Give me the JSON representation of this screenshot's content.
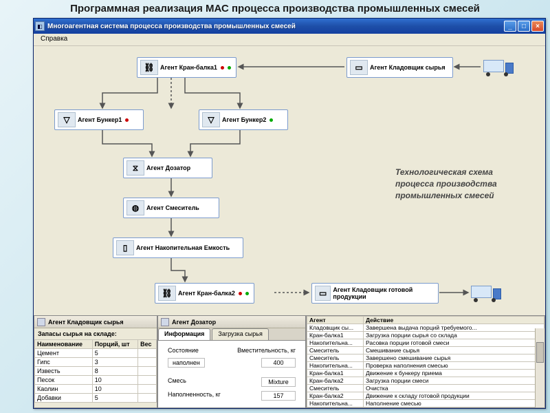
{
  "slide_title": "Программная реализация МАС процесса производства промышленных смесей",
  "window": {
    "title": "Многоагентная система процесса производства промышленных смесей",
    "menu": {
      "help": "Справка"
    }
  },
  "agents": {
    "crane1": "Агент Кран-балка1",
    "storekeeper_raw": "Агент Кладовщик сырья",
    "bunker1": "Агент Бункер1",
    "bunker2": "Агент Бункер2",
    "dozator": "Агент Дозатор",
    "mixer": "Агент Смеситель",
    "storage_tank": "Агент Накопительная Емкость",
    "crane2": "Агент Кран-балка2",
    "storekeeper_out": "Агент Кладовщик готовой продукции"
  },
  "scheme_caption": "Технологическая схема процесса производства промышленных смесей",
  "panel1": {
    "title": "Агент Кладовщик сырья",
    "subtitle": "Запасы сырья на складе:",
    "headers": {
      "name": "Наименование",
      "portions": "Порций, шт",
      "weight": "Вес"
    },
    "rows": [
      {
        "name": "Цемент",
        "p": "5"
      },
      {
        "name": "Гипс",
        "p": "3"
      },
      {
        "name": "Известь",
        "p": "8"
      },
      {
        "name": "Песок",
        "p": "10"
      },
      {
        "name": "Каолин",
        "p": "10"
      },
      {
        "name": "Добавки",
        "p": "5"
      }
    ]
  },
  "panel2": {
    "title": "Агент Дозатор",
    "tabs": {
      "info": "Информация",
      "load": "Загрузка сырья"
    },
    "rows": {
      "state_label": "Состояние",
      "capacity_label": "Вместительность, кг",
      "state": "наполнен",
      "capacity": "400",
      "mix_label": "Смесь",
      "mix": "Mixture",
      "fill_label": "Наполненность, кг",
      "fill": "157"
    }
  },
  "panel3": {
    "headers": {
      "agent": "Агент",
      "action": "Действие"
    },
    "rows": [
      {
        "a": "Кладовщик сы...",
        "d": "Завершена выдача порций требуемого..."
      },
      {
        "a": "Кран-балка1",
        "d": "Загрузка порции сырья со склада"
      },
      {
        "a": "Накопительна...",
        "d": "Расовка порции готовой смеси"
      },
      {
        "a": "Смеситель",
        "d": "Смешивание сырья"
      },
      {
        "a": "Смеситель",
        "d": "Завершено смешивание сырья"
      },
      {
        "a": "Накопительна...",
        "d": "Проверка наполнения смесью"
      },
      {
        "a": "Кран-балка1",
        "d": "Движение к бункеру приема"
      },
      {
        "a": "Кран-балка2",
        "d": "Загрузка порции смеси"
      },
      {
        "a": "Смеситель",
        "d": "Очистка"
      },
      {
        "a": "Кран-балка2",
        "d": "Движение к складу готовой продукции"
      },
      {
        "a": "Накопительна...",
        "d": "Наполнение смесью"
      }
    ]
  }
}
